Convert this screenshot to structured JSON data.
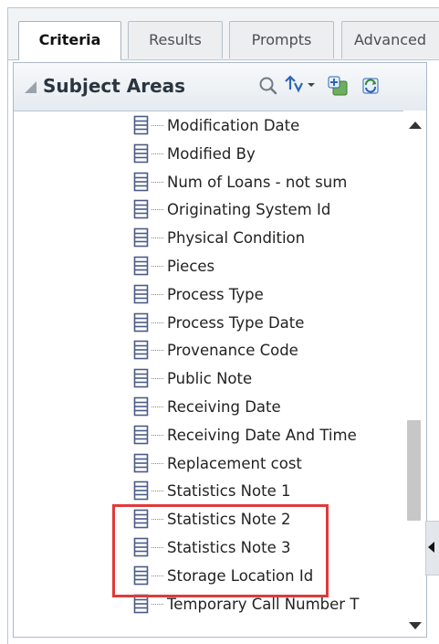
{
  "tabs": [
    {
      "label": "Criteria",
      "active": true
    },
    {
      "label": "Results",
      "active": false
    },
    {
      "label": "Prompts",
      "active": false
    },
    {
      "label": "Advanced",
      "active": false
    }
  ],
  "panel": {
    "title": "Subject Areas",
    "toolbar_icons": [
      "search-icon",
      "sort-icon",
      "add-subject-area-icon",
      "refresh-icon"
    ]
  },
  "tree": {
    "items": [
      {
        "label": "Modification Date"
      },
      {
        "label": "Modified By"
      },
      {
        "label": "Num of Loans - not sum"
      },
      {
        "label": "Originating System Id"
      },
      {
        "label": "Physical Condition"
      },
      {
        "label": "Pieces"
      },
      {
        "label": "Process Type"
      },
      {
        "label": "Process Type Date"
      },
      {
        "label": "Provenance Code"
      },
      {
        "label": "Public Note"
      },
      {
        "label": "Receiving Date"
      },
      {
        "label": "Receiving Date And Time"
      },
      {
        "label": "Replacement cost"
      },
      {
        "label": "Statistics Note 1"
      },
      {
        "label": "Statistics Note 2"
      },
      {
        "label": "Statistics Note 3"
      },
      {
        "label": "Storage Location Id"
      },
      {
        "label": "Temporary Call Number T"
      }
    ],
    "highlighted": [
      "Statistics Note 1",
      "Statistics Note 2",
      "Statistics Note 3"
    ]
  },
  "colors": {
    "highlight_border": "#e03a3a",
    "tab_bar": "#f1f3f5",
    "column_icon": "#4b5b86"
  }
}
